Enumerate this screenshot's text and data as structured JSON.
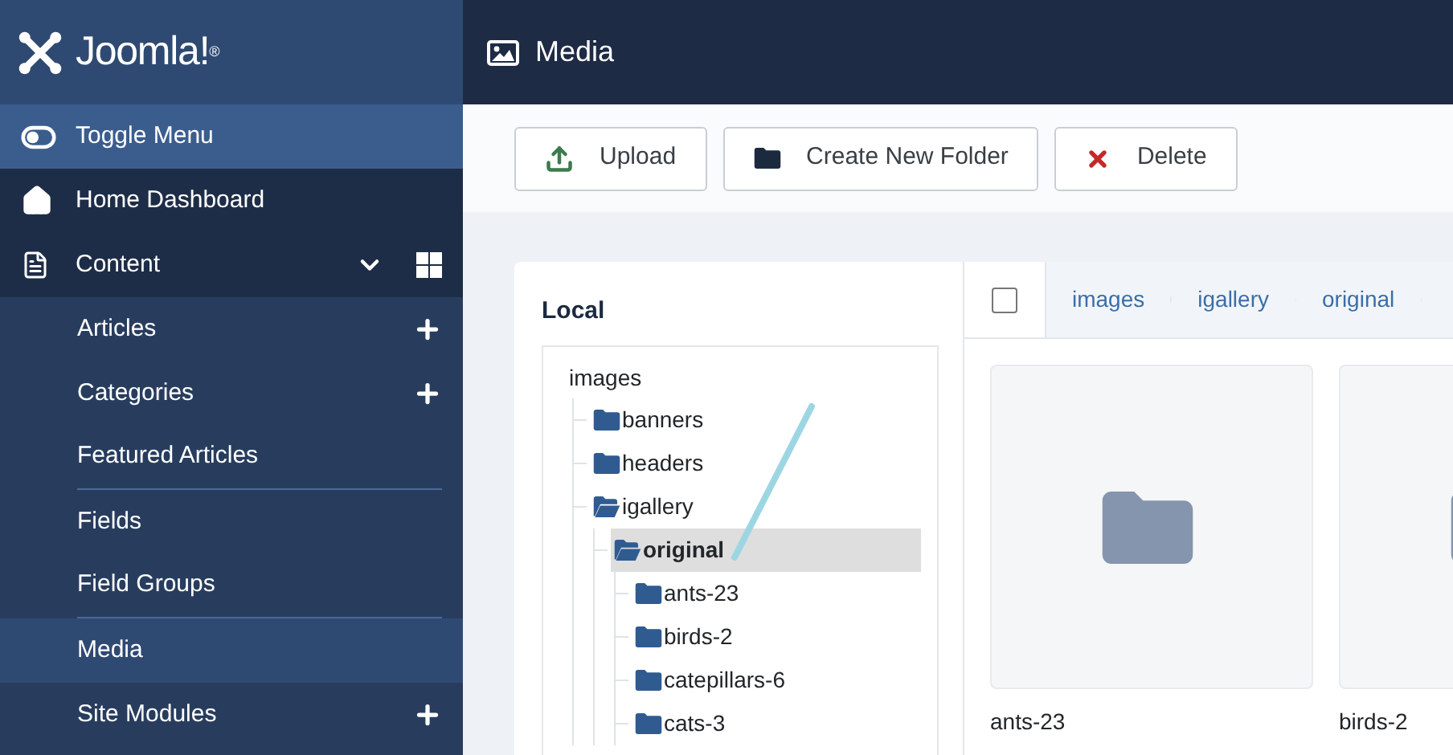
{
  "header": {
    "logo": "Joomla!$^{®}$",
    "title": "Media"
  },
  "sidebar": {
    "items": [
      {
        "label": "Toggle Menu",
        "kind": "toggle"
      },
      {
        "label": "Home Dashboard",
        "kind": "home",
        "selected": false
      },
      {
        "label": "Content",
        "kind": "content",
        "selected": false,
        "expanded": true,
        "children": [
          {
            "label": "Articles",
            "add": true,
            "selected": false,
            "group_end": false
          },
          {
            "label": "Categories",
            "add": true,
            "selected": false,
            "group_end": false
          },
          {
            "label": "Featured Articles",
            "add": false,
            "selected": false,
            "group_end": true
          },
          {
            "label": "Fields",
            "add": false,
            "selected": false,
            "group_end": false
          },
          {
            "label": "Field Groups",
            "add": false,
            "selected": false,
            "group_end": true
          },
          {
            "label": "Media",
            "add": false,
            "selected": true,
            "group_end": false
          },
          {
            "label": "Site Modules",
            "add": true,
            "selected": false,
            "group_end": false
          }
        ]
      }
    ]
  },
  "toolbar": [
    {
      "label": "Upload",
      "kind": "upload"
    },
    {
      "label": "Create New Folder",
      "kind": "folder"
    },
    {
      "label": "Delete",
      "kind": "delete"
    }
  ],
  "tree": {
    "title": "Local",
    "root": "images",
    "children": [
      {
        "label": "banners",
        "expanded": false,
        "selected": false
      },
      {
        "label": "headers",
        "expanded": false,
        "selected": false
      },
      {
        "label": "igallery",
        "expanded": true,
        "selected": false,
        "children": [
          {
            "label": "original",
            "expanded": true,
            "selected": true,
            "children": [
              {
                "label": "ants-23",
                "expanded": false,
                "selected": false
              },
              {
                "label": "birds-2",
                "expanded": false,
                "selected": false
              },
              {
                "label": "catepillars-6",
                "expanded": false,
                "selected": false
              },
              {
                "label": "cats-3",
                "expanded": false,
                "selected": false
              }
            ]
          }
        ]
      }
    ]
  },
  "browser": {
    "select_all": {
      "checked": false
    },
    "breadcrumbs": [
      "images",
      "igallery",
      "original"
    ],
    "items": [
      {
        "name": "ants-23"
      },
      {
        "name": "birds-2"
      }
    ]
  }
}
